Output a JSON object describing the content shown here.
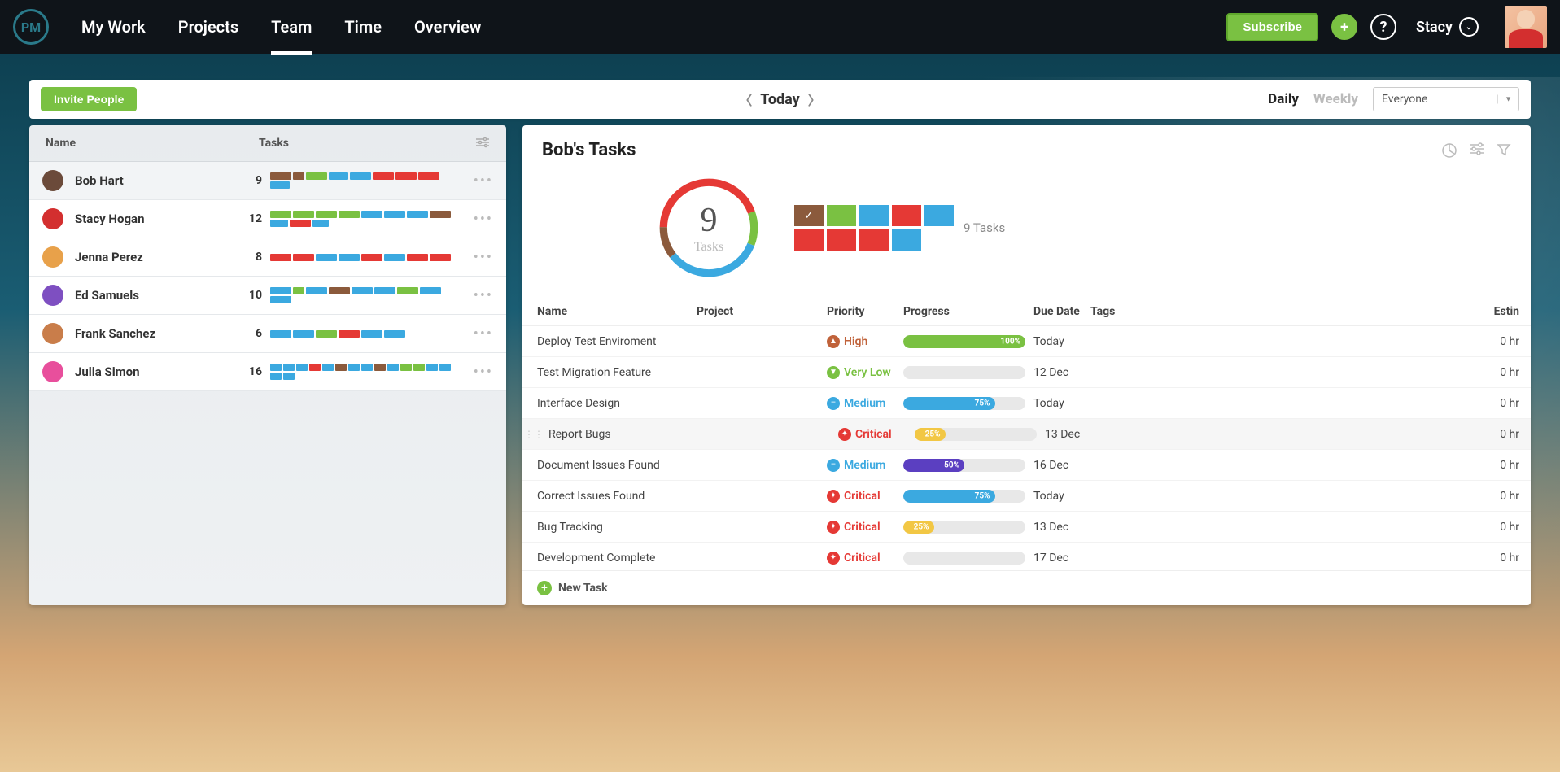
{
  "nav": {
    "logo": "PM",
    "links": [
      "My Work",
      "Projects",
      "Team",
      "Time",
      "Overview"
    ],
    "active_index": 2,
    "subscribe": "Subscribe",
    "user_name": "Stacy"
  },
  "toolbar": {
    "invite": "Invite People",
    "date_label": "Today",
    "toggle_daily": "Daily",
    "toggle_weekly": "Weekly",
    "filter_value": "Everyone"
  },
  "left_panel": {
    "col_name": "Name",
    "col_tasks": "Tasks",
    "members": [
      {
        "name": "Bob Hart",
        "count": 9,
        "avatar": "#6b4a3a",
        "selected": true,
        "segs": [
          [
            "#8b5a3c",
            26
          ],
          [
            "#8b5a3c",
            14
          ],
          [
            "#7ac142",
            26
          ],
          [
            "#3ba9e0",
            24
          ],
          [
            "#3ba9e0",
            26
          ],
          [
            "#e53935",
            26
          ],
          [
            "#e53935",
            26
          ],
          [
            "#e53935",
            26
          ],
          [
            "#3ba9e0",
            24
          ]
        ]
      },
      {
        "name": "Stacy Hogan",
        "count": 12,
        "avatar": "#d32f2f",
        "segs": [
          [
            "#7ac142",
            26
          ],
          [
            "#7ac142",
            26
          ],
          [
            "#7ac142",
            26
          ],
          [
            "#7ac142",
            26
          ],
          [
            "#3ba9e0",
            26
          ],
          [
            "#3ba9e0",
            26
          ],
          [
            "#3ba9e0",
            26
          ],
          [
            "#8b5a3c",
            26
          ],
          [
            "#3ba9e0",
            22
          ],
          [
            "#e53935",
            26
          ],
          [
            "#3ba9e0",
            20
          ]
        ]
      },
      {
        "name": "Jenna Perez",
        "count": 8,
        "avatar": "#e8a14a",
        "segs": [
          [
            "#e53935",
            26
          ],
          [
            "#e53935",
            26
          ],
          [
            "#3ba9e0",
            26
          ],
          [
            "#3ba9e0",
            26
          ],
          [
            "#e53935",
            26
          ],
          [
            "#3ba9e0",
            26
          ],
          [
            "#e53935",
            26
          ],
          [
            "#e53935",
            26
          ]
        ]
      },
      {
        "name": "Ed Samuels",
        "count": 10,
        "avatar": "#7e4fc1",
        "segs": [
          [
            "#3ba9e0",
            26
          ],
          [
            "#7ac142",
            14
          ],
          [
            "#3ba9e0",
            26
          ],
          [
            "#8b5a3c",
            26
          ],
          [
            "#3ba9e0",
            26
          ],
          [
            "#3ba9e0",
            26
          ],
          [
            "#7ac142",
            26
          ],
          [
            "#3ba9e0",
            26
          ],
          [
            "#3ba9e0",
            26
          ]
        ]
      },
      {
        "name": "Frank Sanchez",
        "count": 6,
        "avatar": "#c97d4a",
        "segs": [
          [
            "#3ba9e0",
            26
          ],
          [
            "#3ba9e0",
            26
          ],
          [
            "#7ac142",
            26
          ],
          [
            "#e53935",
            26
          ],
          [
            "#3ba9e0",
            26
          ],
          [
            "#3ba9e0",
            26
          ]
        ]
      },
      {
        "name": "Julia Simon",
        "count": 16,
        "avatar": "#e84f9c",
        "segs": [
          [
            "#3ba9e0",
            14
          ],
          [
            "#3ba9e0",
            14
          ],
          [
            "#3ba9e0",
            14
          ],
          [
            "#e53935",
            14
          ],
          [
            "#3ba9e0",
            14
          ],
          [
            "#8b5a3c",
            14
          ],
          [
            "#3ba9e0",
            14
          ],
          [
            "#3ba9e0",
            14
          ],
          [
            "#8b5a3c",
            14
          ],
          [
            "#3ba9e0",
            14
          ],
          [
            "#7ac142",
            14
          ],
          [
            "#7ac142",
            14
          ],
          [
            "#3ba9e0",
            14
          ],
          [
            "#3ba9e0",
            14
          ],
          [
            "#3ba9e0",
            14
          ],
          [
            "#3ba9e0",
            14
          ]
        ]
      }
    ]
  },
  "right_panel": {
    "title": "Bob's Tasks",
    "donut_num": "9",
    "donut_label": "Tasks",
    "tiles_label": "9 Tasks",
    "tiles": [
      [
        "#8b5a3c",
        "#7ac142",
        "#3ba9e0",
        "#e53935",
        "#3ba9e0"
      ],
      [
        "#e53935",
        "#e53935",
        "#e53935",
        "#3ba9e0"
      ]
    ],
    "columns": {
      "name": "Name",
      "project": "Project",
      "priority": "Priority",
      "progress": "Progress",
      "due": "Due Date",
      "tags": "Tags",
      "est": "Estin"
    },
    "tasks": [
      {
        "name": "Deploy Test Enviroment",
        "priority": "High",
        "prio_color": "#c0623a",
        "prio_icon": "▲",
        "progress": 100,
        "prog_color": "#7ac142",
        "due": "Today",
        "est": "0 hr"
      },
      {
        "name": "Test Migration Feature",
        "priority": "Very Low",
        "prio_color": "#7ac142",
        "prio_icon": "▼",
        "progress": 0,
        "prog_color": "#e8e8e8",
        "due": "12 Dec",
        "est": "0 hr"
      },
      {
        "name": "Interface Design",
        "priority": "Medium",
        "prio_color": "#3ba9e0",
        "prio_icon": "–",
        "progress": 75,
        "prog_color": "#3ba9e0",
        "due": "Today",
        "est": "0 hr"
      },
      {
        "name": "Report Bugs",
        "priority": "Critical",
        "prio_color": "#e53935",
        "prio_icon": "✦",
        "progress": 25,
        "prog_color": "#f2c744",
        "due": "13 Dec",
        "est": "0 hr",
        "hover": true
      },
      {
        "name": "Document Issues Found",
        "priority": "Medium",
        "prio_color": "#3ba9e0",
        "prio_icon": "–",
        "progress": 50,
        "prog_color": "#5b3fc1",
        "due": "16 Dec",
        "est": "0 hr"
      },
      {
        "name": "Correct Issues Found",
        "priority": "Critical",
        "prio_color": "#e53935",
        "prio_icon": "✦",
        "progress": 75,
        "prog_color": "#3ba9e0",
        "due": "Today",
        "est": "0 hr"
      },
      {
        "name": "Bug Tracking",
        "priority": "Critical",
        "prio_color": "#e53935",
        "prio_icon": "✦",
        "progress": 25,
        "prog_color": "#f2c744",
        "due": "13 Dec",
        "est": "0 hr"
      },
      {
        "name": "Development Complete",
        "priority": "Critical",
        "prio_color": "#e53935",
        "prio_icon": "✦",
        "progress": 0,
        "prog_color": "#e8e8e8",
        "due": "17 Dec",
        "est": "0 hr"
      }
    ],
    "new_task": "New Task"
  }
}
